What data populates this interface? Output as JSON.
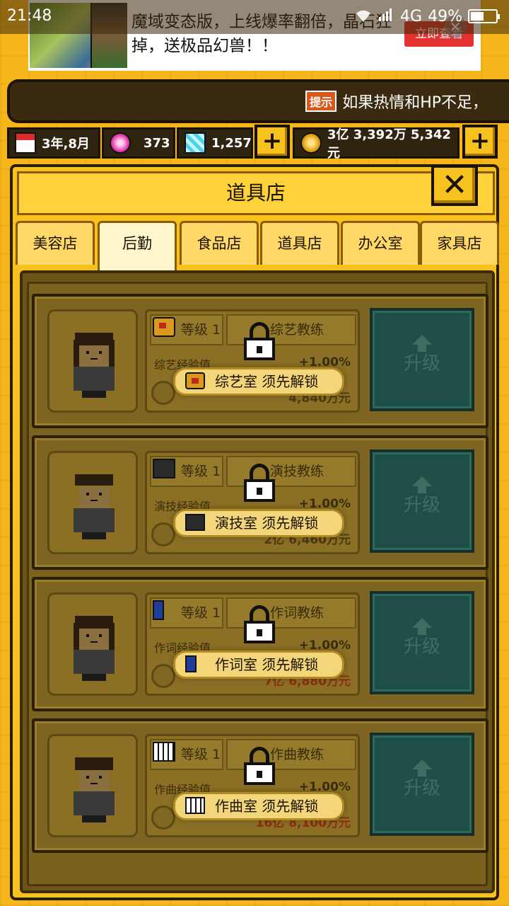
{
  "statusbar": {
    "time": "21:48",
    "network": "4G",
    "battery": "49%",
    "battery_level": 0.49
  },
  "ad": {
    "text": "魔域变态版，上线爆率翻倍，晶石狂掉，送极品幻兽！！",
    "button": "立即查看"
  },
  "tip": {
    "badge": "提示",
    "text": "如果热情和HP不足，"
  },
  "resources": {
    "date": "3年,8月",
    "gems": "373",
    "diamonds": "1,257",
    "money": "3亿 3,392万 5,342元"
  },
  "window": {
    "title": "道具店",
    "close": "✕"
  },
  "tabs": [
    "美容店",
    "后勤",
    "食品店",
    "道具店",
    "办公室",
    "家具店"
  ],
  "active_tab": 1,
  "cards": [
    {
      "level": "等级 1",
      "name": "综艺教练",
      "exp_label": "综艺经验值",
      "exp_value": "+1.00%",
      "cost": "4,840万元",
      "unlock": "综艺室 须先解锁",
      "upgrade": "升级",
      "icon": "variety-icon"
    },
    {
      "level": "等级 1",
      "name": "演技教练",
      "exp_label": "演技经验值",
      "exp_value": "+1.00%",
      "cost": "2亿 6,460万元",
      "unlock": "演技室 须先解锁",
      "upgrade": "升级",
      "icon": "camera-icon"
    },
    {
      "level": "等级 1",
      "name": "作词教练",
      "exp_label": "作词经验值",
      "exp_value": "+1.00%",
      "cost": "7亿 6,880万元",
      "unlock": "作词室 须先解锁",
      "upgrade": "升级",
      "icon": "pen-icon"
    },
    {
      "level": "等级 1",
      "name": "作曲教练",
      "exp_label": "作曲经验值",
      "exp_value": "+1.00%",
      "cost": "16亿 8,100万元",
      "unlock": "作曲室 须先解锁",
      "upgrade": "升级",
      "icon": "piano-icon"
    }
  ]
}
